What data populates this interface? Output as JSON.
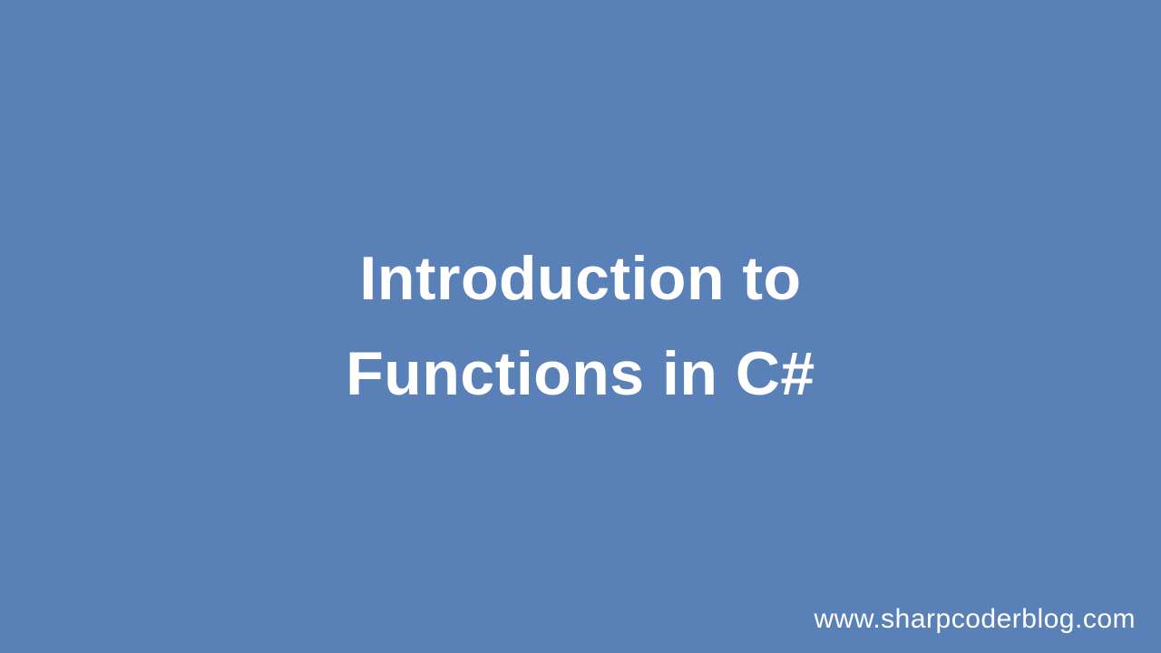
{
  "slide": {
    "title_line1": "Introduction to",
    "title_line2": "Functions in C#",
    "watermark": "www.sharpcoderblog.com",
    "background_color": "#5a80b8",
    "text_color": "#ffffff"
  }
}
